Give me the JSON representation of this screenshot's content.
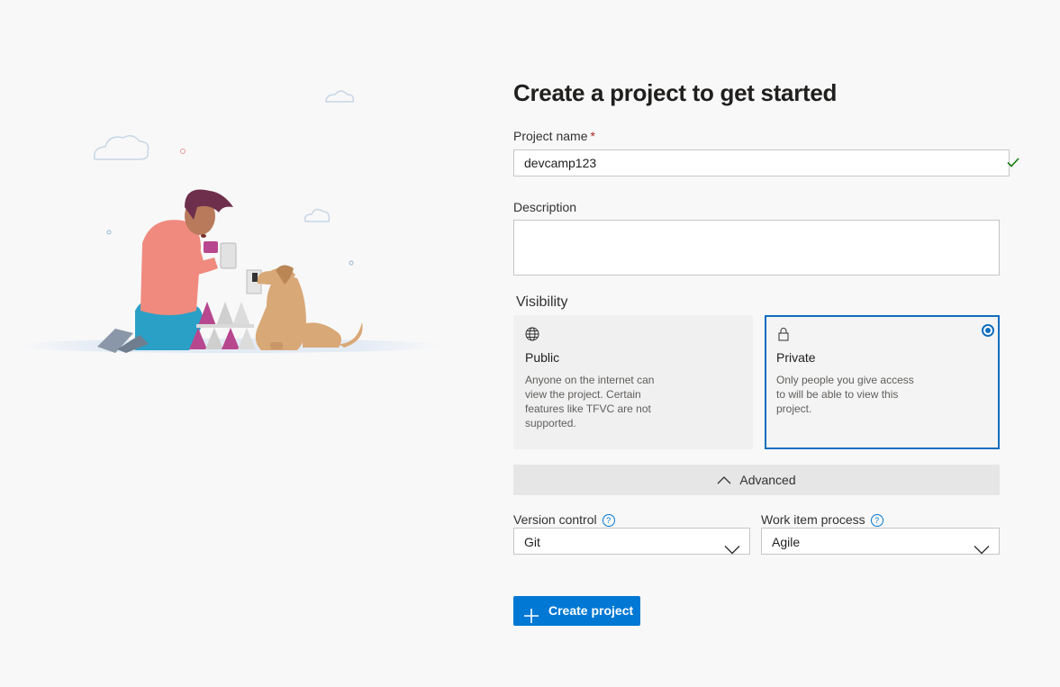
{
  "page": {
    "title": "Create a project to get started"
  },
  "project_name": {
    "label": "Project name",
    "required_mark": "*",
    "value": "devcamp123",
    "valid_icon": "checkmark-icon"
  },
  "description": {
    "label": "Description",
    "value": ""
  },
  "visibility": {
    "label": "Visibility",
    "options": [
      {
        "icon": "globe-icon",
        "title": "Public",
        "description": "Anyone on the internet can view the project. Certain features like TFVC are not supported.",
        "selected": false
      },
      {
        "icon": "lock-icon",
        "title": "Private",
        "description": "Only people you give access to will be able to view this project.",
        "selected": true
      }
    ]
  },
  "advanced": {
    "label": "Advanced",
    "icon": "chevron-up-icon",
    "expanded": true
  },
  "version_control": {
    "label": "Version control",
    "value": "Git",
    "help_icon": "help-icon"
  },
  "work_item_process": {
    "label": "Work item process",
    "value": "Agile",
    "help_icon": "help-icon"
  },
  "create_button": {
    "label": "Create project",
    "icon": "plus-icon"
  },
  "colors": {
    "accent": "#0078d4",
    "valid": "#107c10",
    "required": "#a4262c"
  }
}
